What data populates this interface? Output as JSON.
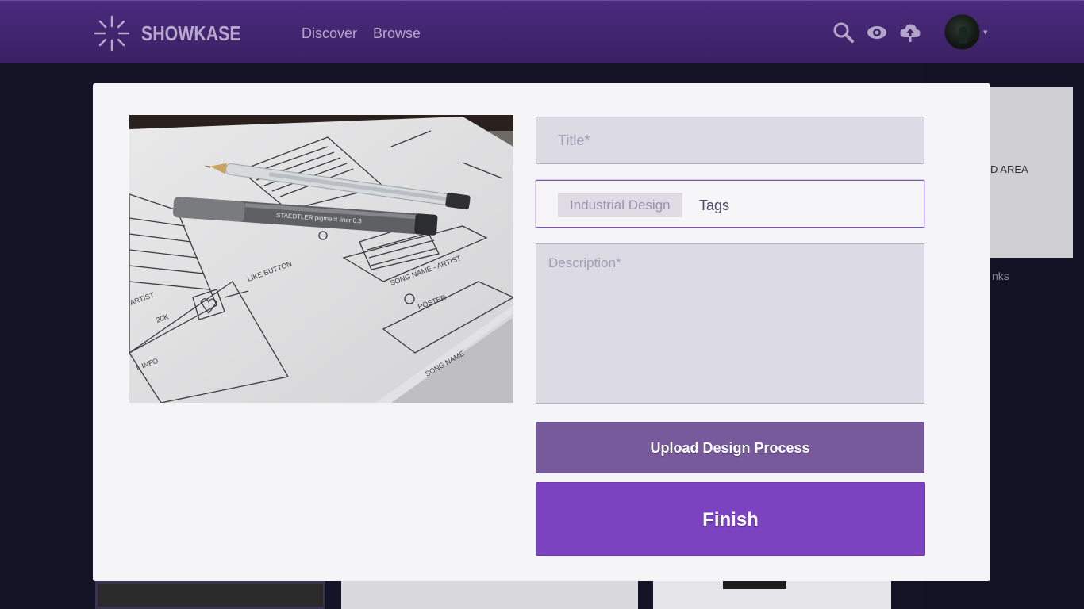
{
  "header": {
    "brand": "SHOWKASE",
    "nav": {
      "discover": "Discover",
      "browse": "Browse"
    },
    "icons": [
      "search-icon",
      "eye-icon",
      "cloud-upload-icon"
    ],
    "caret": "▾"
  },
  "background": {
    "ad_text": "D AREA",
    "links_text": "nks"
  },
  "modal": {
    "title_placeholder": "Title*",
    "tag_chip": "Industrial Design",
    "tags_label": "Tags",
    "description_placeholder": "Description*",
    "upload_button": "Upload Design Process",
    "finish_button": "Finish"
  },
  "colors": {
    "header": "#3b2163",
    "accent": "#7b43bf",
    "upload_button": "#765a9c"
  }
}
